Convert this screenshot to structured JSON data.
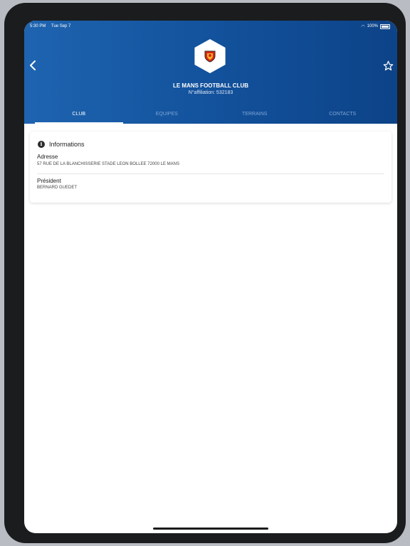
{
  "status_bar": {
    "time": "5:30 PM",
    "date": "Tue Sep 7",
    "battery": "100%"
  },
  "header": {
    "club_name": "LE MANS FOOTBALL CLUB",
    "affiliation": "N°affiliation: 532183"
  },
  "tabs": [
    {
      "label": "CLUB",
      "active": true
    },
    {
      "label": "EQUIPES",
      "active": false
    },
    {
      "label": "TERRAINS",
      "active": false
    },
    {
      "label": "CONTACTS",
      "active": false
    }
  ],
  "info_card": {
    "title": "Informations",
    "address_label": "Adresse",
    "address_value": "57 RUE DE LA BLANCHISSERIE STADE LEON BOLLEE 72000 LE MANS",
    "president_label": "Président",
    "president_value": "BERNARD GUEDET"
  },
  "colors": {
    "header_primary": "#12509a",
    "header_light": "#1e64b0",
    "accent": "#ffffff"
  },
  "icons": {
    "back": "chevron-left-icon",
    "favorite": "star-outline-icon",
    "info": "info-circle-icon",
    "club_crest": "club-crest-icon"
  }
}
